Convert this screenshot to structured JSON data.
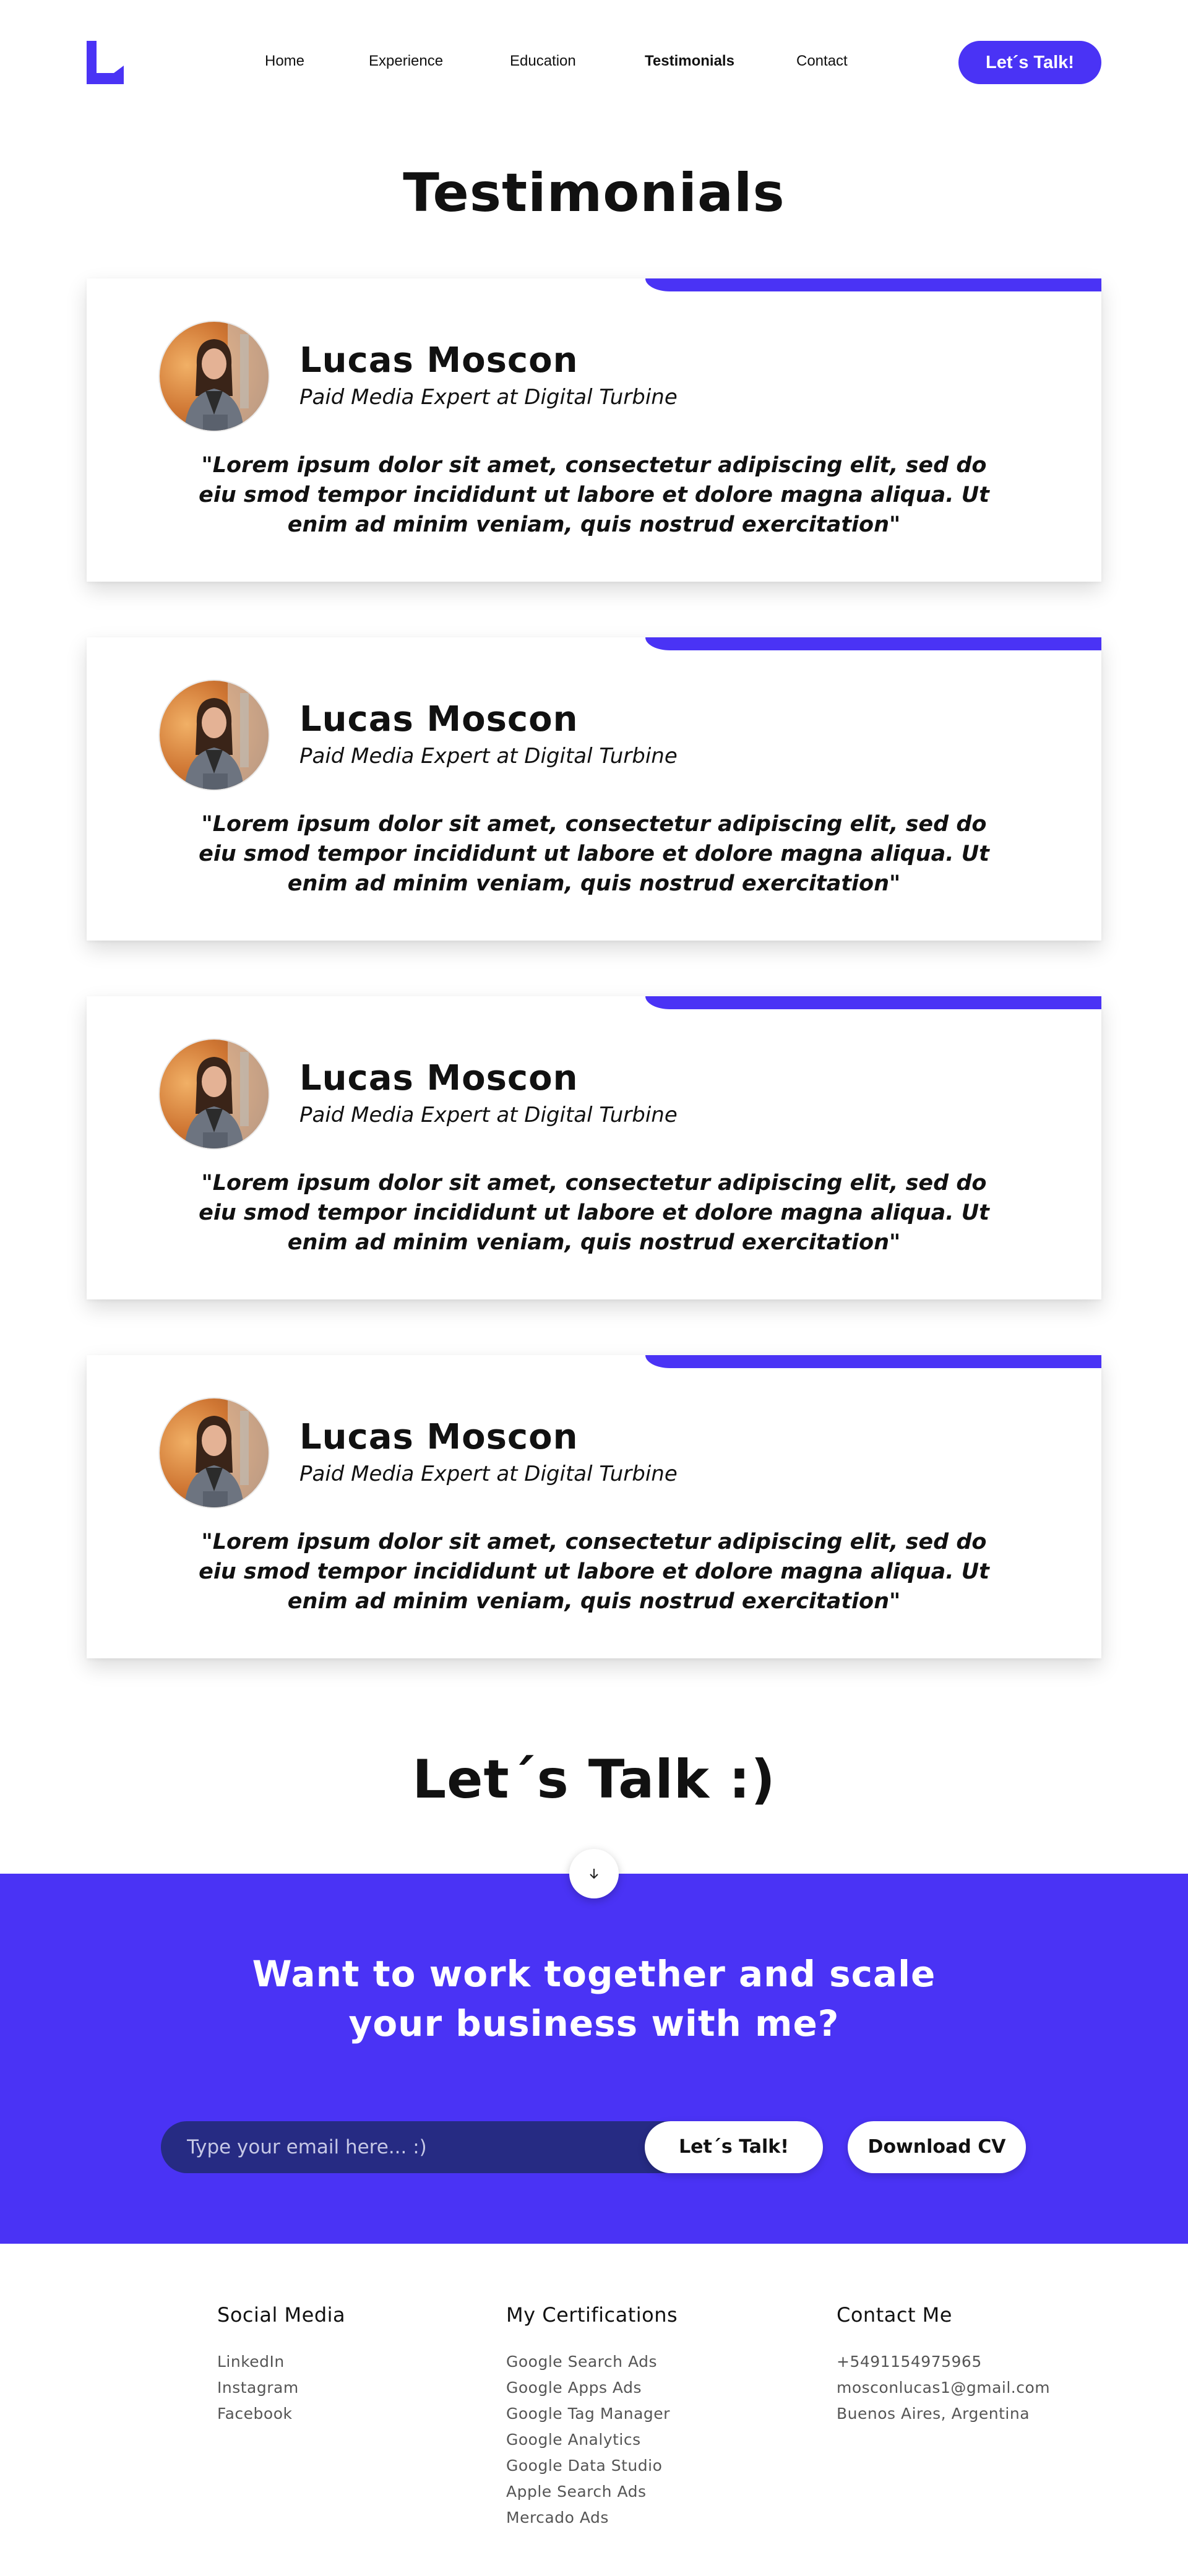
{
  "header": {
    "nav": [
      {
        "label": "Home",
        "active": false
      },
      {
        "label": "Experience",
        "active": false
      },
      {
        "label": "Education",
        "active": false
      },
      {
        "label": "Testimonials",
        "active": true
      },
      {
        "label": "Contact",
        "active": false
      }
    ],
    "cta_label": "Let´s Talk!"
  },
  "testimonials": {
    "title": "Testimonials",
    "items": [
      {
        "name": "Lucas Moscon",
        "role": "Paid Media Expert at Digital Turbine",
        "quote": "\"Lorem ipsum dolor sit amet, consectetur adipiscing elit, sed do eiu smod tempor incididunt ut labore et  dolore magna aliqua. Ut enim ad minim veniam, quis nostrud exercitation\""
      },
      {
        "name": "Lucas Moscon",
        "role": "Paid Media Expert at Digital Turbine",
        "quote": "\"Lorem ipsum dolor sit amet, consectetur adipiscing elit, sed do eiu smod tempor incididunt ut labore et  dolore magna aliqua. Ut enim ad minim veniam, quis nostrud exercitation\""
      },
      {
        "name": "Lucas Moscon",
        "role": "Paid Media Expert at Digital Turbine",
        "quote": "\"Lorem ipsum dolor sit amet, consectetur adipiscing elit, sed do eiu smod tempor incididunt ut labore et  dolore magna aliqua. Ut enim ad minim veniam, quis nostrud exercitation\""
      },
      {
        "name": "Lucas Moscon",
        "role": "Paid Media Expert at Digital Turbine",
        "quote": "\"Lorem ipsum dolor sit amet, consectetur adipiscing elit, sed do eiu smod tempor incididunt ut labore et  dolore magna aliqua. Ut enim ad minim veniam, quis nostrud exercitation\""
      }
    ]
  },
  "contact": {
    "title": "Let´s Talk :)",
    "heading_line1": "Want to work together and scale",
    "heading_line2": "your business with me?",
    "email_placeholder": "Type your email here... :)",
    "submit_label": "Let´s Talk!",
    "cv_label": "Download CV"
  },
  "footer": {
    "social": {
      "title": "Social Media",
      "links": [
        "LinkedIn",
        "Instagram",
        "Facebook"
      ]
    },
    "certifications": {
      "title": "My Certifications",
      "links": [
        "Google Search Ads",
        "Google Apps Ads",
        "Google Tag Manager",
        "Google Analytics",
        "Google Data Studio",
        "Apple Search Ads",
        "Mercado Ads"
      ]
    },
    "contact": {
      "title": "Contact Me",
      "lines": [
        "+5491154975965",
        "mosconlucas1@gmail.com",
        "Buenos Aires, Argentina"
      ]
    }
  },
  "colors": {
    "accent": "#4a33f5",
    "email_field_bg": "#262b83"
  },
  "icons": {
    "logo": "logo-icon",
    "scroll": "arrow-down-icon"
  }
}
